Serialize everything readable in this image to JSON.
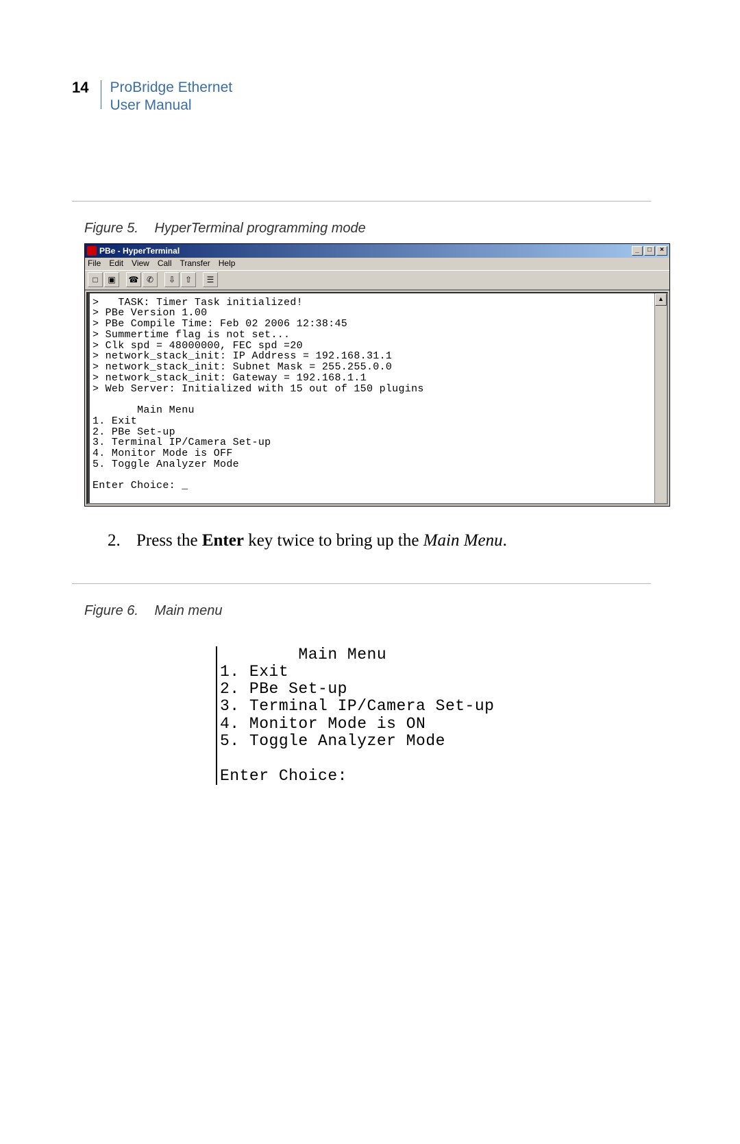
{
  "header": {
    "page_number": "14",
    "title_line1": "ProBridge Ethernet",
    "title_line2": "User Manual"
  },
  "figure5": {
    "label": "Figure 5.",
    "caption": "HyperTerminal programming mode"
  },
  "hyperterminal": {
    "window_title": "PBe - HyperTerminal",
    "menus": [
      "File",
      "Edit",
      "View",
      "Call",
      "Transfer",
      "Help"
    ],
    "win_buttons": {
      "min": "_",
      "max": "□",
      "close": "×"
    },
    "scroll_up_glyph": "▲",
    "toolbar_icons": [
      "new-file-icon",
      "open-file-icon",
      "connect-icon",
      "disconnect-icon",
      "send-icon",
      "receive-icon",
      "properties-icon"
    ],
    "content": ">   TASK: Timer Task initialized!\n> PBe Version 1.00\n> PBe Compile Time: Feb 02 2006 12:38:45\n> Summertime flag is not set...\n> Clk spd = 48000000, FEC spd =20\n> network_stack_init: IP Address = 192.168.31.1\n> network_stack_init: Subnet Mask = 255.255.0.0\n> network_stack_init: Gateway = 192.168.1.1\n> Web Server: Initialized with 15 out of 150 plugins\n\n       Main Menu\n1. Exit\n2. PBe Set-up\n3. Terminal IP/Camera Set-up\n4. Monitor Mode is OFF\n5. Toggle Analyzer Mode\n\nEnter Choice: _"
  },
  "step2": {
    "number": "2.",
    "pre": "Press the ",
    "bold": "Enter",
    "mid": " key twice to bring up the ",
    "italic": "Main Menu",
    "post": "."
  },
  "figure6": {
    "label": "Figure 6.",
    "caption": "Main menu"
  },
  "main_menu_text": "        Main Menu\n1. Exit\n2. PBe Set-up\n3. Terminal IP/Camera Set-up\n4. Monitor Mode is ON\n5. Toggle Analyzer Mode\n\nEnter Choice:"
}
